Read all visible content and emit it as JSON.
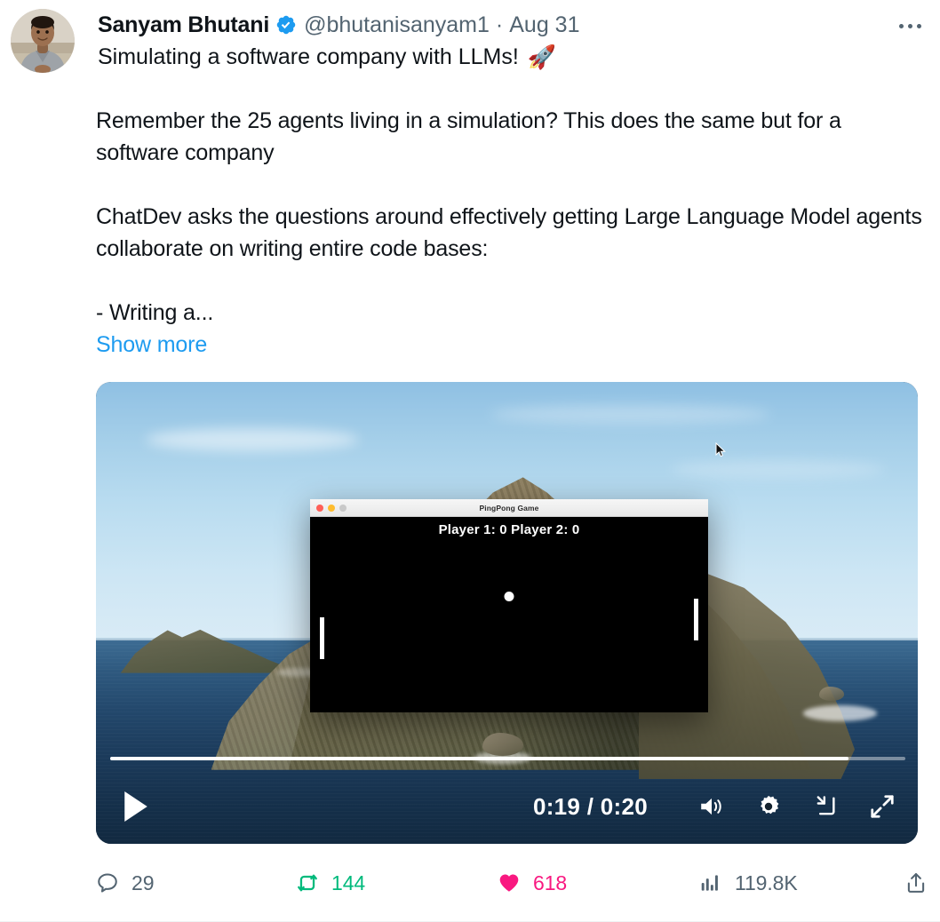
{
  "tweet": {
    "author": {
      "display_name": "Sanyam Bhutani",
      "handle": "@bhutanisanyam1",
      "verified": true,
      "verified_badge_color": "#1d9bf0",
      "avatar_name": "profile-photo"
    },
    "separator": "·",
    "date": "Aug 31",
    "more_options_label": "More",
    "title_text": "Simulating a software company with LLMs!",
    "title_emoji": "🚀",
    "body_paragraph_1": "Remember the 25 agents living in a simulation? This does the same but for a software company",
    "body_paragraph_2": "ChatDev asks the questions around effectively getting Large Language Model agents collaborate on writing entire code bases:",
    "body_paragraph_3": "- Writing a...",
    "show_more_label": "Show more",
    "show_more_color": "#1d9bf0"
  },
  "video": {
    "current_time": "0:19",
    "separator": "/",
    "total_time": "0:20",
    "timecode": "0:19 / 0:20",
    "progress_percent": 93,
    "play_button_label": "Play",
    "volume_label": "Volume",
    "settings_label": "Settings",
    "pip_label": "Picture in picture",
    "fullscreen_label": "Full screen",
    "scene": {
      "wallpaper_name": "macos-catalina-island",
      "cursor_visible": true
    },
    "mac_window": {
      "title": "PingPong Game",
      "traffic_lights": [
        "#ff5f57",
        "#febc2e",
        "#c9c9c9"
      ],
      "score_text": "Player 1: 0  Player 2: 0",
      "player1_label": "Player 1",
      "player1_score": "0",
      "player2_label": "Player 2",
      "player2_score": "0"
    }
  },
  "actions": {
    "reply": {
      "icon": "reply-icon",
      "count": "29",
      "color": "#536471"
    },
    "repost": {
      "icon": "repost-icon",
      "count": "144",
      "color": "#00ba7c"
    },
    "like": {
      "icon": "heart-icon",
      "count": "618",
      "color": "#f91880"
    },
    "views": {
      "icon": "views-icon",
      "count": "119.8K",
      "color": "#536471"
    },
    "share": {
      "icon": "share-icon",
      "color": "#536471"
    }
  }
}
